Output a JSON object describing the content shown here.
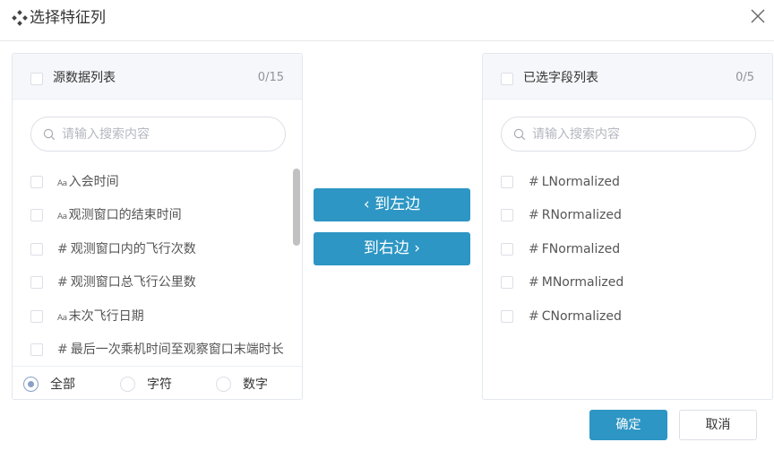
{
  "dialog": {
    "title": "选择特征列"
  },
  "source_panel": {
    "title": "源数据列表",
    "count": "0/15",
    "search_placeholder": "请输入搜索内容",
    "items": [
      {
        "type": "text",
        "type_icon": "Aa",
        "label": "入会时间"
      },
      {
        "type": "text",
        "type_icon": "Aa",
        "label": "观测窗口的结束时间"
      },
      {
        "type": "number",
        "type_icon": "#",
        "label": "观测窗口内的飞行次数"
      },
      {
        "type": "number",
        "type_icon": "#",
        "label": "观测窗口总飞行公里数"
      },
      {
        "type": "text",
        "type_icon": "Aa",
        "label": "末次飞行日期"
      },
      {
        "type": "number",
        "type_icon": "#",
        "label": "最后一次乘机时间至观察窗口末端时长"
      }
    ],
    "filters": [
      {
        "label": "全部",
        "checked": true
      },
      {
        "label": "字符",
        "checked": false
      },
      {
        "label": "数字",
        "checked": false
      }
    ]
  },
  "target_panel": {
    "title": "已选字段列表",
    "count": "0/5",
    "search_placeholder": "请输入搜索内容",
    "items": [
      {
        "type": "number",
        "type_icon": "#",
        "label": "LNormalized"
      },
      {
        "type": "number",
        "type_icon": "#",
        "label": "RNormalized"
      },
      {
        "type": "number",
        "type_icon": "#",
        "label": "FNormalized"
      },
      {
        "type": "number",
        "type_icon": "#",
        "label": "MNormalized"
      },
      {
        "type": "number",
        "type_icon": "#",
        "label": "CNormalized"
      }
    ]
  },
  "transfer": {
    "to_left_label": "到左边",
    "to_right_label": "到右边",
    "to_left_icon": "chevron-left-icon",
    "to_right_icon": "chevron-right-icon"
  },
  "footer": {
    "ok_label": "确定",
    "cancel_label": "取消"
  },
  "colors": {
    "primary": "#2d96c4",
    "radio_checked": "#8aa0c8",
    "panel_header_bg": "#f5f7fa"
  }
}
